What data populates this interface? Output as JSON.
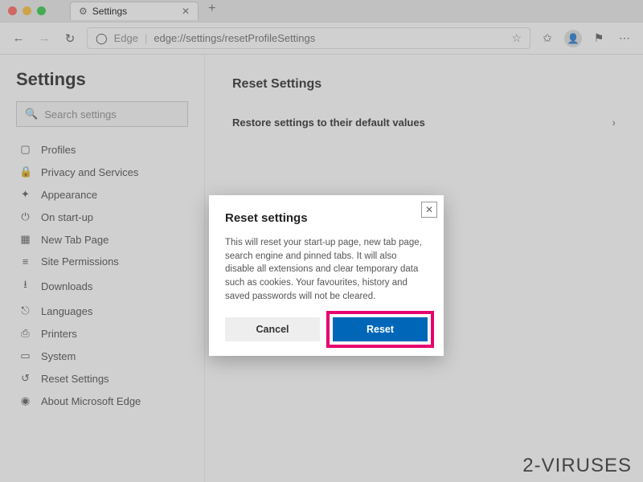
{
  "window": {
    "tab_title": "Settings",
    "address_prefix": "Edge",
    "address_url": "edge://settings/resetProfileSettings"
  },
  "sidebar": {
    "title": "Settings",
    "search_placeholder": "Search settings",
    "items": [
      {
        "icon": "profile-icon",
        "glyph": "▢",
        "label": "Profiles"
      },
      {
        "icon": "lock-icon",
        "glyph": "🔒",
        "label": "Privacy and Services"
      },
      {
        "icon": "appearance-icon",
        "glyph": "✦",
        "label": "Appearance"
      },
      {
        "icon": "power-icon",
        "glyph": "⏻",
        "label": "On start-up"
      },
      {
        "icon": "newtab-icon",
        "glyph": "▦",
        "label": "New Tab Page"
      },
      {
        "icon": "permissions-icon",
        "glyph": "≡",
        "label": "Site Permissions"
      },
      {
        "icon": "download-icon",
        "glyph": "⭳",
        "label": "Downloads"
      },
      {
        "icon": "language-icon",
        "glyph": "⎋",
        "label": "Languages"
      },
      {
        "icon": "printer-icon",
        "glyph": "⎙",
        "label": "Printers"
      },
      {
        "icon": "system-icon",
        "glyph": "▭",
        "label": "System"
      },
      {
        "icon": "reset-icon",
        "glyph": "↺",
        "label": "Reset Settings"
      },
      {
        "icon": "edge-icon",
        "glyph": "◉",
        "label": "About Microsoft Edge"
      }
    ]
  },
  "main": {
    "heading": "Reset Settings",
    "row_label": "Restore settings to their default values"
  },
  "modal": {
    "title": "Reset settings",
    "body": "This will reset your start-up page, new tab page, search engine and pinned tabs. It will also disable all extensions and clear temporary data such as cookies. Your favourites, history and saved passwords will not be cleared.",
    "cancel": "Cancel",
    "reset": "Reset"
  },
  "watermark": "2-VIRUSES"
}
